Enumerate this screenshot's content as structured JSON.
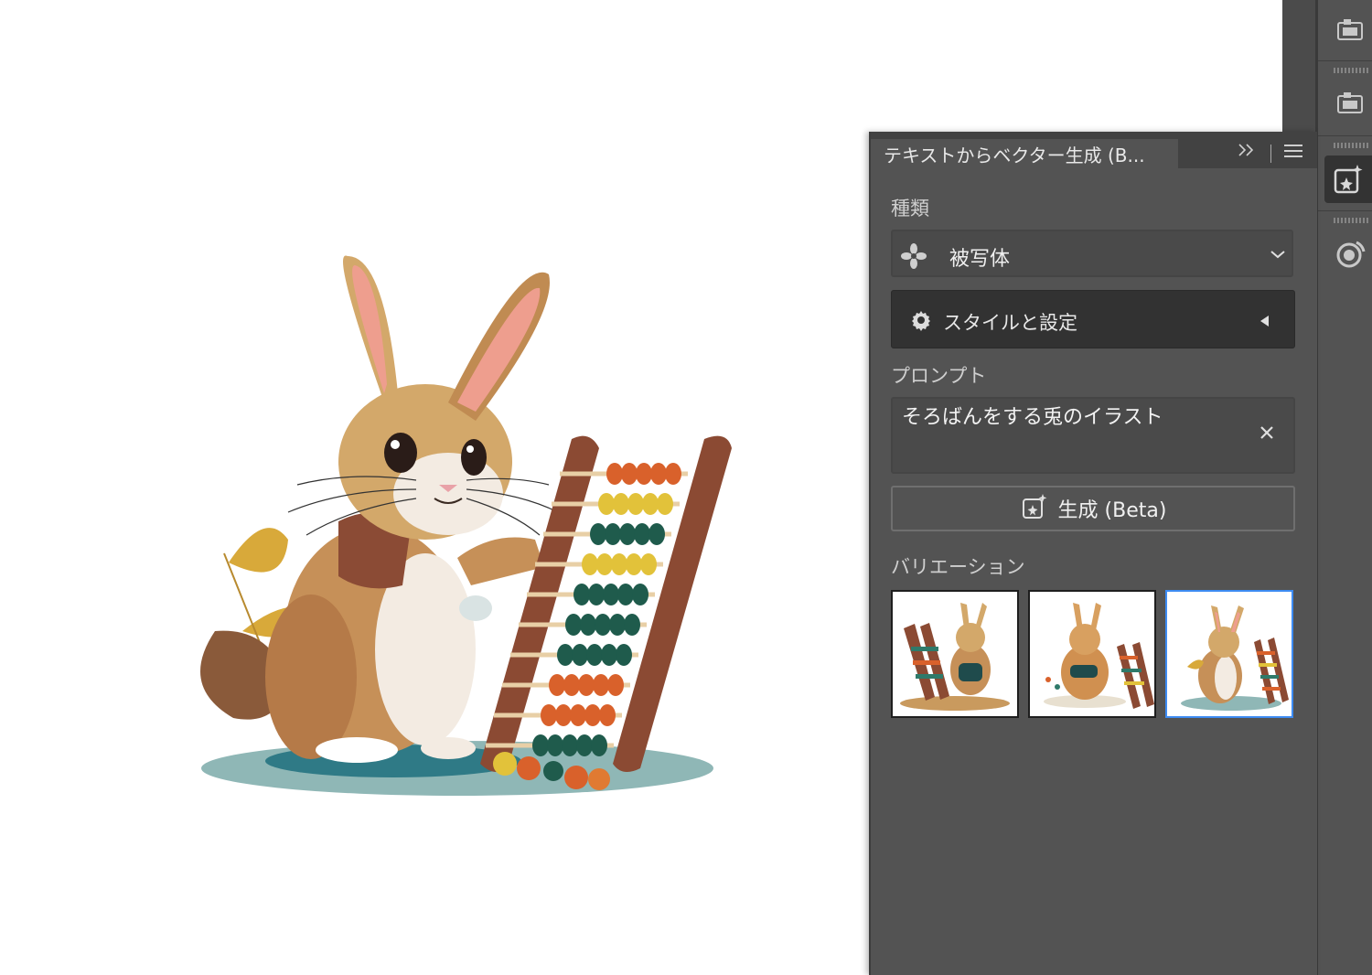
{
  "panel": {
    "title": "テキストからベクター生成 (B...",
    "collapse_icon": "double-chevron-right-icon",
    "menu_icon": "hamburger-menu-icon",
    "type_section": {
      "label": "種類",
      "selected_value": "被写体",
      "icon": "subject-icon"
    },
    "style_section": {
      "label": "スタイルと設定",
      "icon": "gear-icon",
      "state": "collapsed"
    },
    "prompt_section": {
      "label": "プロンプト",
      "value": "そろばんをする兎のイラスト",
      "clear_icon": "close-icon"
    },
    "generate_button": {
      "label": "生成 (Beta)",
      "icon": "generative-sparkle-icon"
    },
    "variations": {
      "label": "バリエーション",
      "count": 3,
      "selected_index": 2
    }
  },
  "dock": {
    "items": [
      "properties-panel-icon",
      "libraries-panel-icon",
      "text-to-vector-icon",
      "recolor-icon"
    ],
    "active_index": 2
  },
  "colors": {
    "panel_bg": "#535353",
    "header_bg": "#424242",
    "selection": "#3d8bf2",
    "canvas_bg": "#ffffff"
  }
}
